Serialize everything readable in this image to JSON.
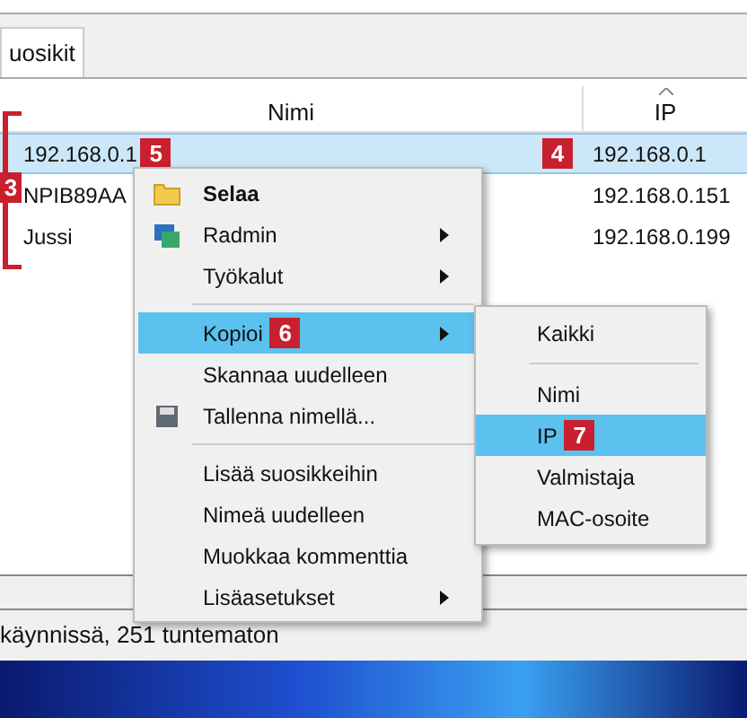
{
  "tabs": [
    {
      "label": "uosikit",
      "selected": true
    }
  ],
  "table": {
    "columns": [
      "Nimi",
      "IP"
    ],
    "rows": [
      {
        "name": "192.168.0.1",
        "name_callout": "5",
        "ip_callout": "4",
        "ip": "192.168.0.1",
        "selected": true
      },
      {
        "name": "NPIB89AA",
        "ip": "192.168.0.151",
        "selected": false
      },
      {
        "name": "Jussi",
        "ip": "192.168.0.199",
        "selected": false
      }
    ]
  },
  "bracket_callout": "3",
  "context_menu": {
    "items": [
      {
        "kind": "item",
        "label": "Selaa",
        "bold": true,
        "submenu": false,
        "selected": false
      },
      {
        "kind": "item",
        "label": "Radmin",
        "bold": false,
        "submenu": true,
        "selected": false
      },
      {
        "kind": "item",
        "label": "Työkalut",
        "bold": false,
        "submenu": true,
        "selected": false
      },
      {
        "kind": "separator"
      },
      {
        "kind": "item",
        "label": "Kopioi",
        "badge": "6",
        "bold": false,
        "submenu": true,
        "selected": true
      },
      {
        "kind": "item",
        "label": "Skannaa uudelleen",
        "bold": false,
        "submenu": false,
        "selected": false
      },
      {
        "kind": "item",
        "label": "Tallenna nimellä...",
        "bold": false,
        "submenu": false,
        "selected": false
      },
      {
        "kind": "separator"
      },
      {
        "kind": "item",
        "label": "Lisää suosikkeihin",
        "bold": false,
        "submenu": false,
        "selected": false
      },
      {
        "kind": "item",
        "label": "Nimeä uudelleen",
        "bold": false,
        "submenu": false,
        "selected": false
      },
      {
        "kind": "item",
        "label": "Muokkaa kommenttia",
        "bold": false,
        "submenu": false,
        "selected": false
      },
      {
        "kind": "item",
        "label": "Lisäasetukset",
        "bold": false,
        "submenu": true,
        "selected": false
      }
    ]
  },
  "submenu": {
    "items": [
      {
        "kind": "item",
        "label": "Kaikki",
        "selected": false
      },
      {
        "kind": "separator"
      },
      {
        "kind": "item",
        "label": "Nimi",
        "selected": false
      },
      {
        "kind": "item",
        "label": "IP",
        "badge": "7",
        "selected": true
      },
      {
        "kind": "item",
        "label": "Valmistaja",
        "selected": false
      },
      {
        "kind": "item",
        "label": "MAC-osoite",
        "selected": false
      }
    ]
  },
  "status_bar": "käynnissä, 251 tuntematon"
}
